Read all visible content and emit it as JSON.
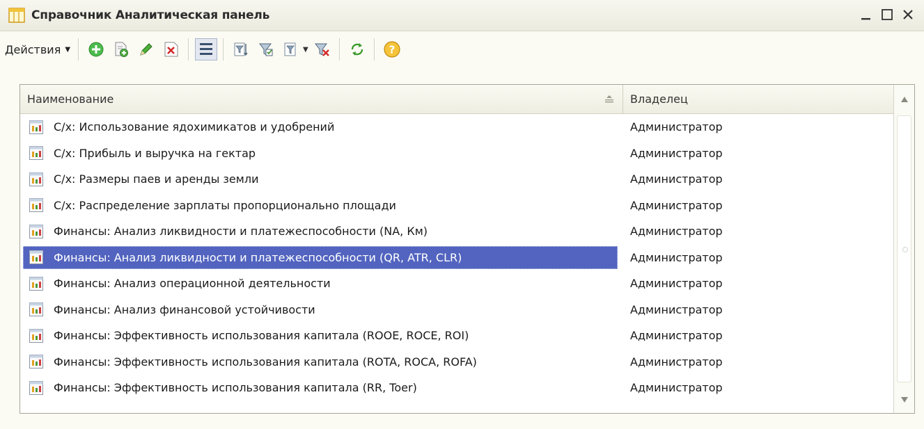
{
  "window": {
    "title": "Справочник Аналитическая панель",
    "minimize_label": "_",
    "maximize_label": "□",
    "close_label": "×"
  },
  "toolbar": {
    "actions_label": "Действия",
    "buttons": [
      {
        "name": "add-icon",
        "color": "#3fae3f"
      },
      {
        "name": "copy-icon",
        "color": "#58a848"
      },
      {
        "name": "edit-pencil-icon",
        "color": "#3a9a2a"
      },
      {
        "name": "delete-icon",
        "color": "#d23030"
      },
      {
        "name": "hierarchy-view-icon",
        "color": "#2f4f6f"
      },
      {
        "name": "filter-set-icon",
        "color": "#6a7a8a"
      },
      {
        "name": "filter-by-value-icon",
        "color": "#6a7a8a"
      },
      {
        "name": "filter-history-icon",
        "color": "#6a7a8a"
      },
      {
        "name": "filter-clear-icon",
        "color": "#d23030"
      },
      {
        "name": "refresh-icon",
        "color": "#3a9a2a"
      },
      {
        "name": "help-icon",
        "color": "#f0b020"
      }
    ]
  },
  "table": {
    "columns": {
      "name": "Наименование",
      "owner": "Владелец"
    },
    "selected_index": 5,
    "rows": [
      {
        "name": "С/х: Использование ядохимикатов и удобрений",
        "owner": "Администратор"
      },
      {
        "name": "С/х: Прибыль и выручка на гектар",
        "owner": "Администратор"
      },
      {
        "name": "С/х: Размеры паев и аренды земли",
        "owner": "Администратор"
      },
      {
        "name": "С/х: Распределение зарплаты пропорционально площади",
        "owner": "Администратор"
      },
      {
        "name": "Финансы: Анализ ликвидности и платежеспособности (NA, Км)",
        "owner": "Администратор"
      },
      {
        "name": "Финансы: Анализ ликвидности и платежеспособности (QR, ATR, CLR)",
        "owner": "Администратор"
      },
      {
        "name": "Финансы: Анализ операционной деятельности",
        "owner": "Администратор"
      },
      {
        "name": "Финансы: Анализ финансовой устойчивости",
        "owner": "Администратор"
      },
      {
        "name": "Финансы: Эффективность использования капитала (ROOE, ROCE, ROI)",
        "owner": "Администратор"
      },
      {
        "name": "Финансы: Эффективность использования капитала (ROTA, ROCA, ROFA)",
        "owner": "Администратор"
      },
      {
        "name": "Финансы: Эффективность использования капитала (RR, Toer)",
        "owner": "Администратор"
      }
    ]
  },
  "colors": {
    "selection": "#5264bf",
    "window_bg": "#fbfbf4",
    "border": "#a7a596"
  }
}
